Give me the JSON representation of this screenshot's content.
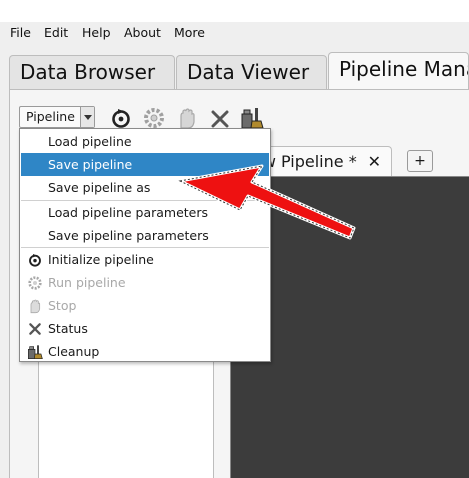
{
  "menubar": {
    "items": [
      "File",
      "Edit",
      "Help",
      "About",
      "More"
    ]
  },
  "main_tabs": [
    {
      "label": "Data Browser"
    },
    {
      "label": "Data Viewer"
    },
    {
      "label": "Pipeline Manager"
    }
  ],
  "toolbar": {
    "pipeline_combo_label": "Pipeline",
    "icons": [
      "initialize-icon",
      "run-icon",
      "stop-icon",
      "status-icon",
      "cleanup-icon"
    ]
  },
  "editor": {
    "tab_label": "New Pipeline *",
    "close_glyph": "✕",
    "add_tab_label": "+"
  },
  "dropdown": {
    "items": [
      {
        "label": "Load pipeline",
        "state": "normal"
      },
      {
        "label": "Save pipeline",
        "state": "selected"
      },
      {
        "label": "Save pipeline as",
        "state": "normal"
      },
      {
        "label": "Load pipeline parameters",
        "state": "normal"
      },
      {
        "label": "Save pipeline parameters",
        "state": "normal"
      },
      {
        "label": "Initialize pipeline",
        "state": "normal",
        "icon": "initialize-icon"
      },
      {
        "label": "Run pipeline",
        "state": "disabled",
        "icon": "run-icon"
      },
      {
        "label": "Stop",
        "state": "disabled",
        "icon": "stop-icon"
      },
      {
        "label": "Status",
        "state": "normal",
        "icon": "status-icon"
      },
      {
        "label": "Cleanup",
        "state": "normal",
        "icon": "cleanup-icon"
      }
    ]
  },
  "colors": {
    "selection": "#2f86c6",
    "editor_background": "#3c3c3c",
    "annotation_arrow": "#ee1111"
  }
}
